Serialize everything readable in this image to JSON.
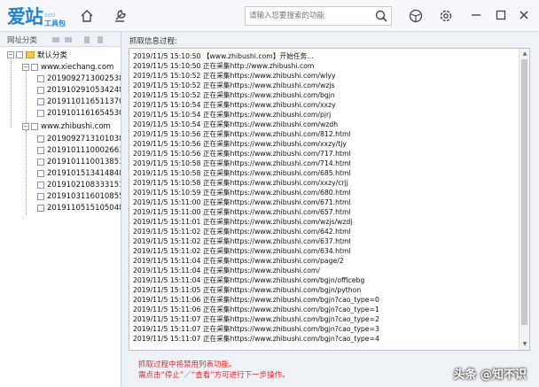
{
  "app": {
    "logo_main": "爱站",
    "logo_seo": "seo",
    "logo_sub": "工具包",
    "search_placeholder": "请输入您要搜索的功能"
  },
  "left_panel": {
    "header": "网址分类",
    "tree": {
      "root": "默认分类",
      "sites": [
        {
          "name": "www.xiechang.com",
          "items": [
            "20190927130025387",
            "20191029105342480",
            "20191101165113700",
            "20191011616545304"
          ]
        },
        {
          "name": "www.zhibushi.com",
          "items": [
            "20190927131010386",
            "20191011100026630",
            "20191011100138534",
            "20191015134148484",
            "20191021083331511",
            "20191031160108554",
            "20191105151050487"
          ]
        }
      ]
    }
  },
  "right_panel": {
    "title": "抓取信息过程:",
    "log_lines": [
      "2019/11/5 15:10:50 【www.zhibushi.com】开始任务...",
      "2019/11/5 15:10:50 正在采集http://www.zhibushi.com",
      "2019/11/5 15:10:52 正在采集https://www.zhibushi.com/wlyy",
      "2019/11/5 15:10:52 正在采集https://www.zhibushi.com/wzjs",
      "2019/11/5 15:10:52 正在采集https://www.zhibushi.com/bgjn",
      "2019/11/5 15:10:54 正在采集https://www.zhibushi.com/xxzy",
      "2019/11/5 15:10:54 正在采集https://www.zhibushi.com/pjrj",
      "2019/11/5 15:10:54 正在采集https://www.zhibushi.com/wzdh",
      "2019/11/5 15:10:56 正在采集https://www.zhibushi.com/812.html",
      "2019/11/5 15:10:56 正在采集https://www.zhibushi.com/xxzy/tjy",
      "2019/11/5 15:10:56 正在采集https://www.zhibushi.com/717.html",
      "2019/11/5 15:10:58 正在采集https://www.zhibushi.com/714.html",
      "2019/11/5 15:10:58 正在采集https://www.zhibushi.com/685.html",
      "2019/11/5 15:10:58 正在采集https://www.zhibushi.com/xxzy/crjj",
      "2019/11/5 15:10:59 正在采集https://www.zhibushi.com/680.html",
      "2019/11/5 15:11:00 正在采集https://www.zhibushi.com/671.html",
      "2019/11/5 15:11:00 正在采集https://www.zhibushi.com/657.html",
      "2019/11/5 15:11:01 正在采集https://www.zhibushi.com/wzjs/wzdj",
      "2019/11/5 15:11:02 正在采集https://www.zhibushi.com/642.html",
      "2019/11/5 15:11:02 正在采集https://www.zhibushi.com/637.html",
      "2019/11/5 15:11:02 正在采集https://www.zhibushi.com/634.html",
      "2019/11/5 15:11:04 正在采集https://www.zhibushi.com/page/2",
      "2019/11/5 15:11:04 正在采集https://www.zhibushi.com/",
      "2019/11/5 15:11:04 正在采集https://www.zhibushi.com/bgjn/officebg",
      "2019/11/5 15:11:05 正在采集https://www.zhibushi.com/bgjn/python",
      "2019/11/5 15:11:06 正在采集https://www.zhibushi.com/bgjn?cao_type=0",
      "2019/11/5 15:11:06 正在采集https://www.zhibushi.com/bgjn?cao_type=1",
      "2019/11/5 15:11:07 正在采集https://www.zhibushi.com/bgjn?cao_type=2",
      "2019/11/5 15:11:07 正在采集https://www.zhibushi.com/bgjn?cao_type=3",
      "2019/11/5 15:11:07 正在采集https://www.zhibushi.com/bgjn?cao_type=4"
    ],
    "notice_line1": "抓取过程中将禁用列表功能。",
    "notice_line2": "需点击“停止”／“查看”方可进行下一步操作。"
  },
  "watermark": "头条 @知不识",
  "colors": {
    "brand": "#1d86d6",
    "notice": "#e02a2a"
  }
}
